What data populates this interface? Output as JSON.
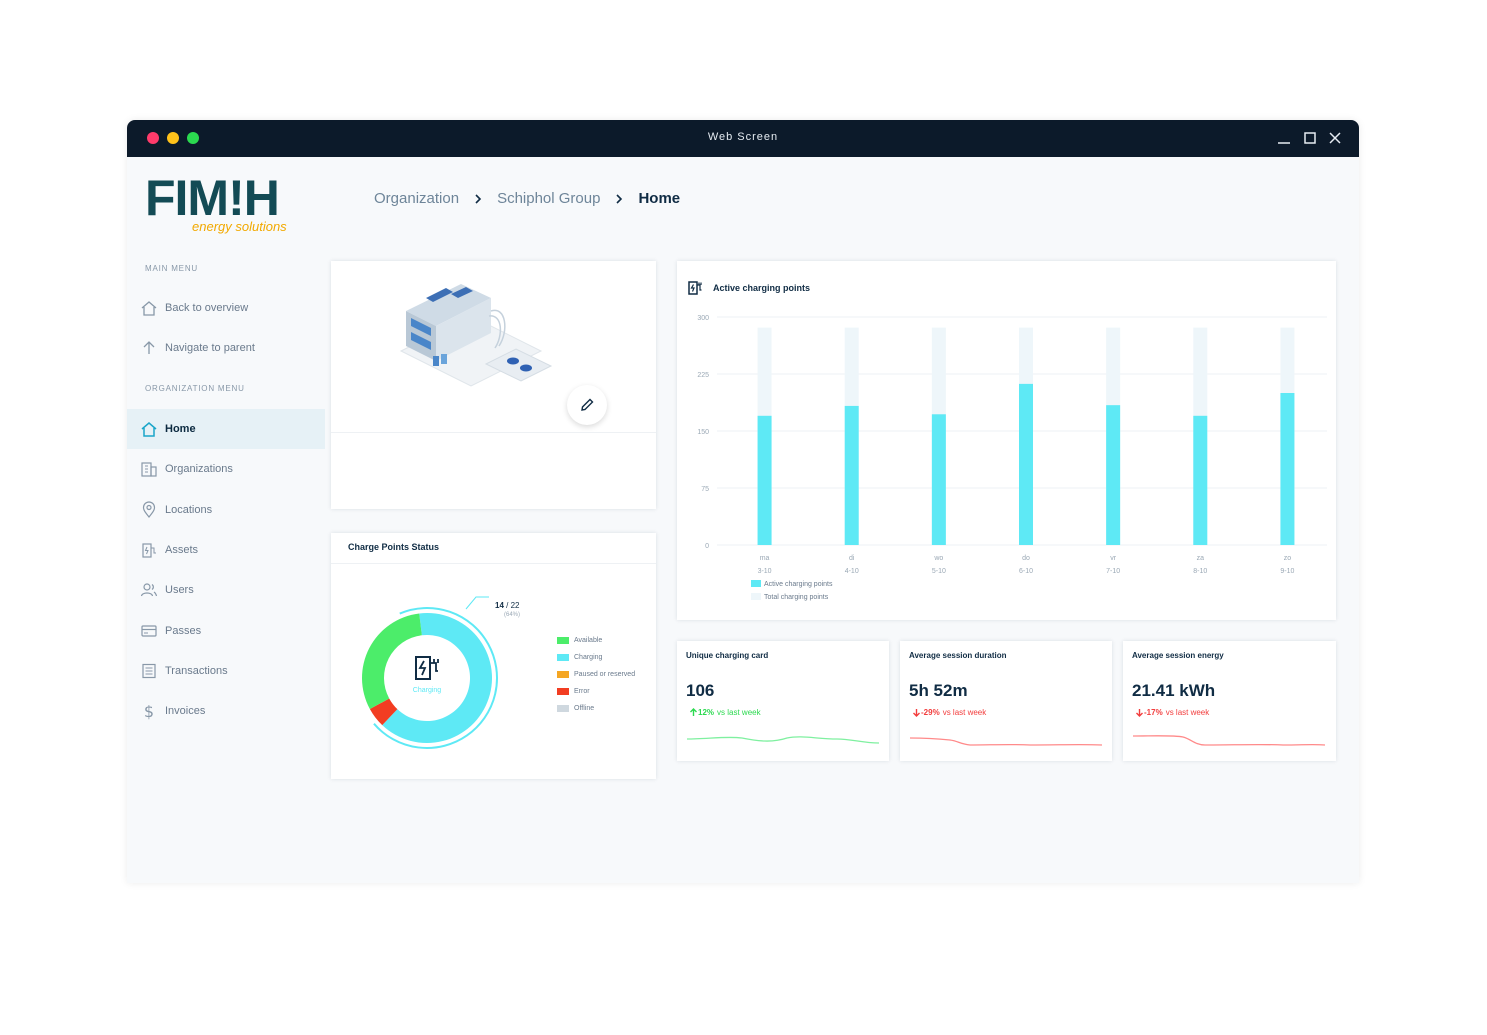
{
  "window": {
    "title": "Web Screen"
  },
  "brand": {
    "logo_main": "FIM!H",
    "logo_sub": "energy solutions",
    "accent": "#f2a900",
    "primary": "#134b55"
  },
  "sidebar": {
    "main_heading": "MAIN MENU",
    "main_items": [
      {
        "label": "Back to overview",
        "icon": "home-icon"
      },
      {
        "label": "Navigate to parent",
        "icon": "arrow-up-icon"
      }
    ],
    "org_heading": "ORGANIZATION MENU",
    "org_items": [
      {
        "label": "Home",
        "icon": "home-icon",
        "active": true
      },
      {
        "label": "Organizations",
        "icon": "building-icon"
      },
      {
        "label": "Locations",
        "icon": "location-pin-icon"
      },
      {
        "label": "Assets",
        "icon": "charger-icon"
      },
      {
        "label": "Users",
        "icon": "users-icon"
      },
      {
        "label": "Passes",
        "icon": "card-icon"
      },
      {
        "label": "Transactions",
        "icon": "list-icon"
      },
      {
        "label": "Invoices",
        "icon": "dollar-icon"
      }
    ]
  },
  "breadcrumb": [
    "Organization",
    "Schiphol Group",
    "Home"
  ],
  "status_card": {
    "title": "Charge Points Status",
    "center_label": "Charging",
    "callout_value": "14",
    "callout_total": "22",
    "callout_pct": "(64%)",
    "legend": [
      {
        "label": "Available",
        "color": "#4ced6a"
      },
      {
        "label": "Charging",
        "color": "#5ee9f5"
      },
      {
        "label": "Paused or reserved",
        "color": "#f5a623"
      },
      {
        "label": "Error",
        "color": "#f23d22"
      },
      {
        "label": "Offline",
        "color": "#cfd8df"
      }
    ]
  },
  "chart_data": {
    "type": "bar",
    "title": "Active charging points",
    "categories": [
      "ma",
      "di",
      "wo",
      "do",
      "vr",
      "za",
      "zo"
    ],
    "dates": [
      "3-10",
      "4-10",
      "5-10",
      "6-10",
      "7-10",
      "8-10",
      "9-10"
    ],
    "yticks": [
      0,
      75,
      150,
      225,
      300
    ],
    "ylim": [
      0,
      300
    ],
    "series": [
      {
        "name": "Active charging points",
        "color": "#5ee9f5",
        "values": [
          170,
          183,
          172,
          212,
          184,
          170,
          200
        ]
      },
      {
        "name": "Total charging points",
        "color": "#eef6fa",
        "values": [
          286,
          286,
          286,
          286,
          286,
          286,
          286
        ]
      }
    ],
    "legend": "bottom-left",
    "grid": true
  },
  "stats": [
    {
      "title": "Unique charging card",
      "value": "106",
      "pct": "12%",
      "suffix": "vs last week",
      "trend": "up",
      "color": "#2bd94f"
    },
    {
      "title": "Average session duration",
      "value": "5h 52m",
      "pct": "-29%",
      "suffix": "vs last week",
      "trend": "down",
      "color": "#f23d3d"
    },
    {
      "title": "Average session energy",
      "value": "21.41 kWh",
      "pct": "-17%",
      "suffix": "vs last week",
      "trend": "down",
      "color": "#f23d3d"
    }
  ]
}
